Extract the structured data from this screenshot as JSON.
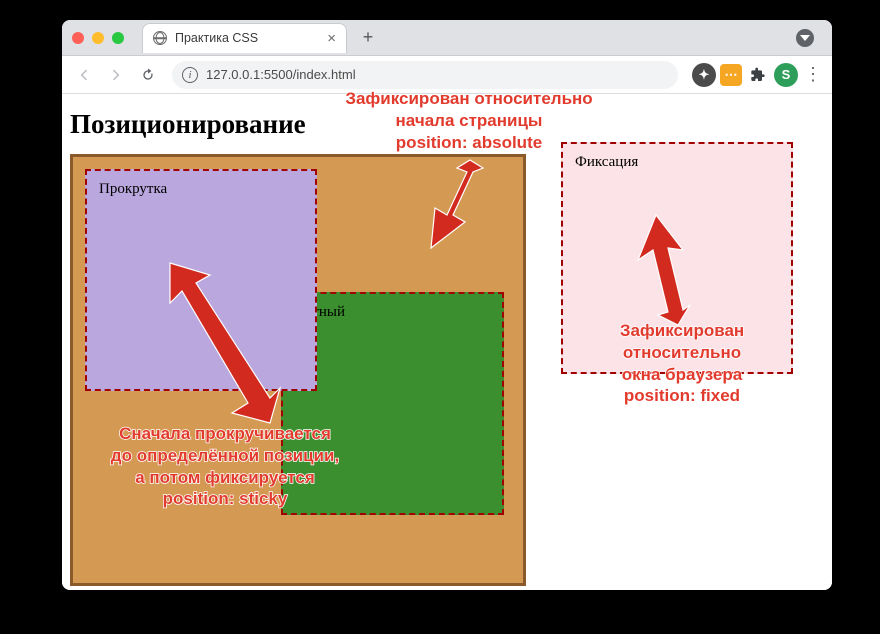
{
  "browser": {
    "tab_title": "Практика CSS",
    "url_display": "127.0.0.1:5500/index.html",
    "profile_initial": "S",
    "info_glyph": "i",
    "close_glyph": "×",
    "plus_glyph": "+",
    "kebab_glyph": "⋮",
    "ext_orange_glyph": "⋯",
    "ext_dark_glyph": "✦"
  },
  "page": {
    "heading": "Позиционирование",
    "sticky_label": "Прокрутка",
    "absolute_label": "Абсолютный",
    "absolute_label_visible_fragment": "тный",
    "fixed_label": "Фиксация"
  },
  "annotations": {
    "absolute": "Зафиксирован относительно\nначала страницы\nposition: absolute",
    "fixed": "Зафиксирован\nотносительно\nокна браузера\nposition: fixed",
    "sticky": "Сначала прокручивается\nдо определённой позиции,\nа потом фиксируется\nposition: sticky"
  }
}
